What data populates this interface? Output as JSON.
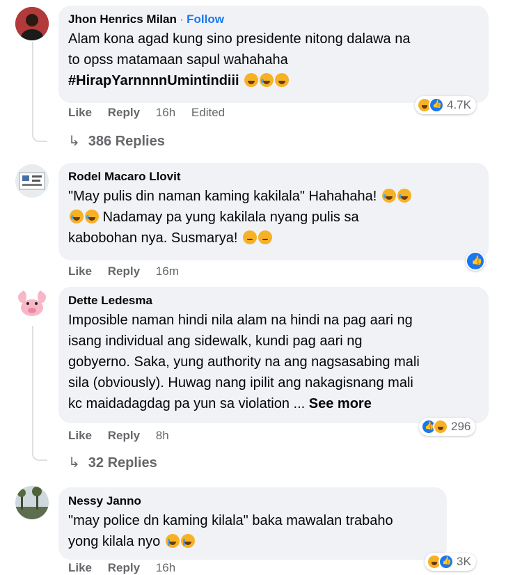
{
  "comments": [
    {
      "author": "Jhon Henrics Milan",
      "follow_separator": "·",
      "follow": "Follow",
      "lines": [
        "Alam kona agad kung sino presidente nitong dalawa na",
        "to opss matamaan sapul wahahaha"
      ],
      "hashtag": "#HirapYarnnnnUmintindiii",
      "actions": {
        "like": "Like",
        "reply": "Reply",
        "time": "16h",
        "edited": "Edited"
      },
      "reactions": {
        "icons": [
          "haha-icon",
          "like-icon"
        ],
        "count": "4.7K"
      },
      "replies": "386 Replies"
    },
    {
      "author": "Rodel Macaro Llovit",
      "lines": [
        "\"May pulis din naman kaming kakilala\" Hahahaha!",
        "Nadamay pa yung kakilala nyang pulis sa",
        "kabobohan nya. Susmarya!"
      ],
      "actions": {
        "like": "Like",
        "reply": "Reply",
        "time": "16m"
      },
      "reactions": {
        "icons": [
          "like-icon"
        ]
      }
    },
    {
      "author": "Dette Ledesma",
      "lines": [
        "Imposible naman hindi nila alam na hindi na pag aari ng",
        "isang individual ang sidewalk, kundi pag aari ng",
        "gobyerno. Saka, yung authority na ang nagsasabing mali",
        "sila (obviously). Huwag nang ipilit ang nakagisnang mali",
        "kc maidadagdag pa yun sa violation ..."
      ],
      "see_more": "See more",
      "actions": {
        "like": "Like",
        "reply": "Reply",
        "time": "8h"
      },
      "reactions": {
        "icons": [
          "like-icon",
          "haha-icon"
        ],
        "count": "296"
      },
      "replies": "32 Replies"
    },
    {
      "author": "Nessy Janno",
      "lines": [
        "\"may police dn kaming kilala\" baka mawalan trabaho",
        "yong kilala nyo"
      ],
      "actions": {
        "like": "Like",
        "reply": "Reply",
        "time": "16h"
      },
      "reactions": {
        "icons": [
          "haha-icon",
          "like-icon"
        ],
        "count": "3K"
      }
    }
  ],
  "colors": {
    "bubble": "#f0f2f5",
    "link": "#1877f2",
    "meta": "#65676b",
    "text": "#050505",
    "haha": "#f7b125",
    "like": "#1877f2"
  }
}
